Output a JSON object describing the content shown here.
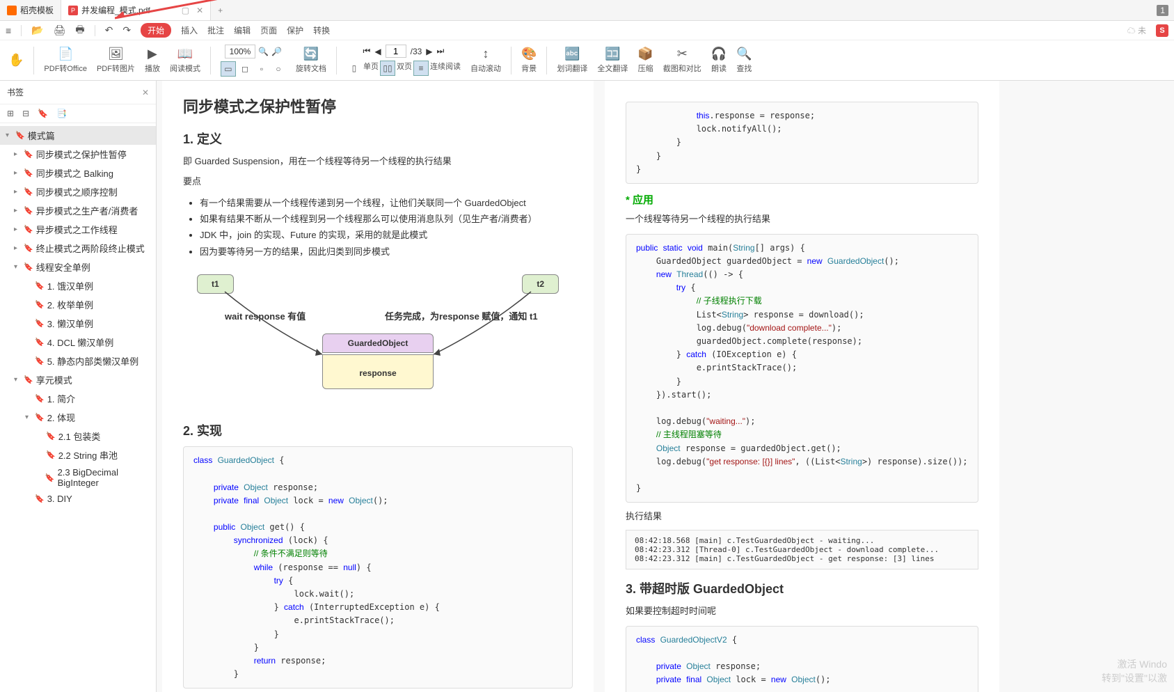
{
  "tabs": {
    "t1": "稻壳模板",
    "t2": "并发编程_模式.pdf",
    "badge": "1"
  },
  "menu": {
    "start": "开始",
    "insert": "插入",
    "batch": "批注",
    "edit": "编辑",
    "page": "页面",
    "protect": "保护",
    "convert": "转换"
  },
  "ribbon": {
    "pdf_office": "PDF转Office",
    "pdf_img": "PDF转图片",
    "play": "播放",
    "read_mode": "阅读模式",
    "zoom": "100%",
    "rotate": "旋转文档",
    "single": "单页",
    "double": "双页",
    "continuous": "连续阅读",
    "autoscroll": "自动滚动",
    "bg": "背景",
    "select_translate": "划词翻译",
    "full_translate": "全文翻译",
    "compress": "压缩",
    "screenshot": "截图和对比",
    "speak": "朗读",
    "find": "查找",
    "page_current": "1",
    "page_total": "33"
  },
  "sidebar": {
    "title": "书签",
    "items": [
      {
        "label": "模式篇",
        "lvl": 0,
        "arrow": "▾",
        "sel": true
      },
      {
        "label": "同步模式之保护性暂停",
        "lvl": 1,
        "arrow": "▸"
      },
      {
        "label": "同步模式之 Balking",
        "lvl": 1,
        "arrow": "▸"
      },
      {
        "label": "同步模式之顺序控制",
        "lvl": 1,
        "arrow": "▸"
      },
      {
        "label": "异步模式之生产者/消费者",
        "lvl": 1,
        "arrow": "▸"
      },
      {
        "label": "异步模式之工作线程",
        "lvl": 1,
        "arrow": "▸"
      },
      {
        "label": "终止模式之两阶段终止模式",
        "lvl": 1,
        "arrow": "▸"
      },
      {
        "label": "线程安全单例",
        "lvl": 1,
        "arrow": "▾"
      },
      {
        "label": "1. 饿汉单例",
        "lvl": 2
      },
      {
        "label": "2. 枚举单例",
        "lvl": 2
      },
      {
        "label": "3. 懒汉单例",
        "lvl": 2
      },
      {
        "label": "4. DCL 懒汉单例",
        "lvl": 2
      },
      {
        "label": "5. 静态内部类懒汉单例",
        "lvl": 2
      },
      {
        "label": "享元模式",
        "lvl": 1,
        "arrow": "▾"
      },
      {
        "label": "1. 简介",
        "lvl": 2
      },
      {
        "label": "2. 体现",
        "lvl": 2,
        "arrow": "▾"
      },
      {
        "label": "2.1 包装类",
        "lvl": 3
      },
      {
        "label": "2.2 String 串池",
        "lvl": 3
      },
      {
        "label": "2.3 BigDecimal BigInteger",
        "lvl": 3
      },
      {
        "label": "3. DIY",
        "lvl": 2
      }
    ]
  },
  "doc": {
    "h1": "同步模式之保护性暂停",
    "s1_h": "1. 定义",
    "s1_p1": "即 Guarded Suspension，用在一个线程等待另一个线程的执行结果",
    "s1_p2": "要点",
    "s1_li1": "有一个结果需要从一个线程传递到另一个线程，让他们关联同一个 GuardedObject",
    "s1_li2": "如果有结果不断从一个线程到另一个线程那么可以使用消息队列（见生产者/消费者）",
    "s1_li3": "JDK 中，join 的实现、Future 的实现，采用的就是此模式",
    "s1_li4": "因为要等待另一方的结果，因此归类到同步模式",
    "diag": {
      "t1": "t1",
      "t2": "t2",
      "go": "GuardedObject",
      "resp": "response",
      "l1": "wait response 有值",
      "l2": "任务完成，为response 赋值，通知 t1"
    },
    "s2_h": "2. 实现",
    "p2": {
      "h3": "* 应用",
      "p1": "一个线程等待另一个线程的执行结果",
      "res": "执行结果",
      "log": "08:42:18.568 [main] c.TestGuardedObject - waiting...\n08:42:23.312 [Thread-0] c.TestGuardedObject - download complete...\n08:42:23.312 [main] c.TestGuardedObject - get response: [3] lines",
      "h2b": "3. 带超时版 GuardedObject",
      "p2": "如果要控制超时时间呢"
    }
  },
  "watermark": {
    "l1": "激活 Windo",
    "l2": "转到\"设置\"以激"
  }
}
